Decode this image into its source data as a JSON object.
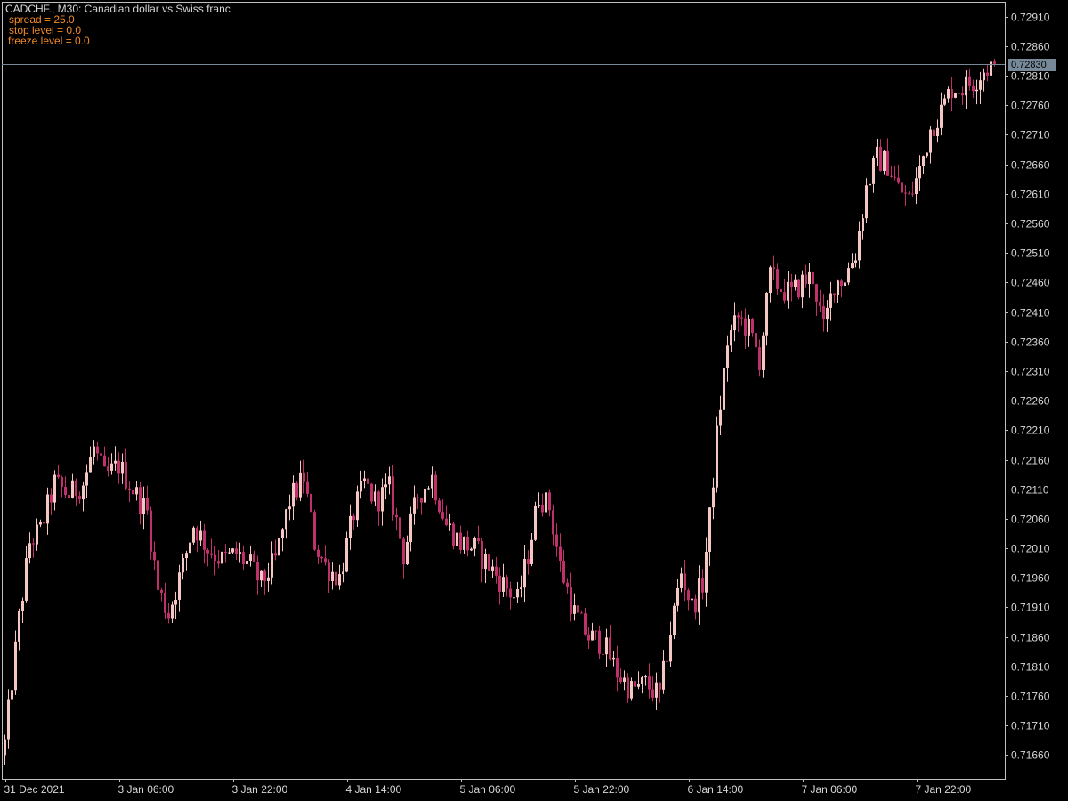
{
  "header": {
    "symbol": "CADCHF.",
    "timeframe": "M30",
    "description": "Canadian dollar vs Swiss franc",
    "title_text": "CADCHF., M30:  Canadian dollar vs Swiss franc"
  },
  "info_lines": [
    {
      "label": "spread",
      "value": "25.0",
      "text": "spread = 25.0"
    },
    {
      "label": "stop level",
      "value": "0.0",
      "text": "stop level = 0.0"
    },
    {
      "label": "freeze level",
      "value": "0.0",
      "text": "freeze level = 0.0"
    }
  ],
  "colors": {
    "background": "#000000",
    "axis": "#c0c0c0",
    "text": "#d7d7d7",
    "info_text": "#f08a24",
    "bull": "#f4c7c3",
    "bear": "#c0306a",
    "green": "#2e8b2e",
    "price_line": "#778899"
  },
  "current_price": {
    "value": 0.7283,
    "label": "0.72830"
  },
  "chart_data": {
    "type": "candlestick",
    "title": "CADCHF., M30:  Canadian dollar vs Swiss franc",
    "ylim": [
      0.7162,
      0.72935
    ],
    "y_ticks": [
      {
        "value": 0.7291,
        "label": "0.72910"
      },
      {
        "value": 0.7286,
        "label": "0.72860"
      },
      {
        "value": 0.7281,
        "label": "0.72810"
      },
      {
        "value": 0.7276,
        "label": "0.72760"
      },
      {
        "value": 0.7271,
        "label": "0.72710"
      },
      {
        "value": 0.7266,
        "label": "0.72660"
      },
      {
        "value": 0.7261,
        "label": "0.72610"
      },
      {
        "value": 0.7256,
        "label": "0.72560"
      },
      {
        "value": 0.7251,
        "label": "0.72510"
      },
      {
        "value": 0.7246,
        "label": "0.72460"
      },
      {
        "value": 0.7241,
        "label": "0.72410"
      },
      {
        "value": 0.7236,
        "label": "0.72360"
      },
      {
        "value": 0.7231,
        "label": "0.72310"
      },
      {
        "value": 0.7226,
        "label": "0.72260"
      },
      {
        "value": 0.7221,
        "label": "0.72210"
      },
      {
        "value": 0.7216,
        "label": "0.72160"
      },
      {
        "value": 0.7211,
        "label": "0.72110"
      },
      {
        "value": 0.7206,
        "label": "0.72060"
      },
      {
        "value": 0.7201,
        "label": "0.72010"
      },
      {
        "value": 0.7196,
        "label": "0.71960"
      },
      {
        "value": 0.7191,
        "label": "0.71910"
      },
      {
        "value": 0.7186,
        "label": "0.71860"
      },
      {
        "value": 0.7181,
        "label": "0.71810"
      },
      {
        "value": 0.7176,
        "label": "0.71760"
      },
      {
        "value": 0.7171,
        "label": "0.71710"
      },
      {
        "value": 0.7166,
        "label": "0.71660"
      }
    ],
    "x_ticks": [
      {
        "bar": 0,
        "label": "31 Dec 2021"
      },
      {
        "bar": 32,
        "label": "3 Jan 06:00"
      },
      {
        "bar": 64,
        "label": "3 Jan 22:00"
      },
      {
        "bar": 96,
        "label": "4 Jan 14:00"
      },
      {
        "bar": 128,
        "label": "5 Jan 06:00"
      },
      {
        "bar": 160,
        "label": "5 Jan 22:00"
      },
      {
        "bar": 192,
        "label": "6 Jan 14:00"
      },
      {
        "bar": 224,
        "label": "7 Jan 06:00"
      },
      {
        "bar": 256,
        "label": "7 Jan 22:00"
      }
    ],
    "close_path": [
      [
        0,
        0.7168
      ],
      [
        4,
        0.7189
      ],
      [
        7,
        0.7202
      ],
      [
        10,
        0.7204
      ],
      [
        14,
        0.7212
      ],
      [
        18,
        0.721
      ],
      [
        22,
        0.7212
      ],
      [
        25,
        0.7218
      ],
      [
        28,
        0.7213
      ],
      [
        32,
        0.7215
      ],
      [
        36,
        0.7211
      ],
      [
        40,
        0.7207
      ],
      [
        43,
        0.7194
      ],
      [
        46,
        0.719
      ],
      [
        50,
        0.7198
      ],
      [
        53,
        0.7205
      ],
      [
        57,
        0.7201
      ],
      [
        61,
        0.7199
      ],
      [
        65,
        0.72
      ],
      [
        69,
        0.7198
      ],
      [
        72,
        0.7195
      ],
      [
        76,
        0.7199
      ],
      [
        80,
        0.7209
      ],
      [
        84,
        0.7213
      ],
      [
        87,
        0.7202
      ],
      [
        90,
        0.7198
      ],
      [
        94,
        0.7196
      ],
      [
        98,
        0.7207
      ],
      [
        101,
        0.7212
      ],
      [
        104,
        0.7209
      ],
      [
        108,
        0.7211
      ],
      [
        112,
        0.72
      ],
      [
        116,
        0.721
      ],
      [
        120,
        0.7213
      ],
      [
        124,
        0.7205
      ],
      [
        128,
        0.7202
      ],
      [
        132,
        0.7201
      ],
      [
        136,
        0.7198
      ],
      [
        140,
        0.7195
      ],
      [
        144,
        0.7192
      ],
      [
        147,
        0.72
      ],
      [
        150,
        0.721
      ],
      [
        153,
        0.7208
      ],
      [
        156,
        0.7198
      ],
      [
        160,
        0.719
      ],
      [
        164,
        0.7186
      ],
      [
        168,
        0.7185
      ],
      [
        172,
        0.718
      ],
      [
        176,
        0.7177
      ],
      [
        180,
        0.7178
      ],
      [
        184,
        0.7176
      ],
      [
        187,
        0.7187
      ],
      [
        190,
        0.7197
      ],
      [
        193,
        0.7191
      ],
      [
        196,
        0.7195
      ],
      [
        198,
        0.7206
      ],
      [
        200,
        0.722
      ],
      [
        203,
        0.7236
      ],
      [
        206,
        0.724
      ],
      [
        209,
        0.7238
      ],
      [
        212,
        0.7233
      ],
      [
        215,
        0.7247
      ],
      [
        218,
        0.7245
      ],
      [
        221,
        0.7244
      ],
      [
        224,
        0.7246
      ],
      [
        227,
        0.7247
      ],
      [
        230,
        0.7238
      ],
      [
        233,
        0.7246
      ],
      [
        236,
        0.7247
      ],
      [
        239,
        0.7251
      ],
      [
        242,
        0.7262
      ],
      [
        245,
        0.7267
      ],
      [
        248,
        0.7266
      ],
      [
        251,
        0.7262
      ],
      [
        254,
        0.726
      ],
      [
        257,
        0.7265
      ],
      [
        260,
        0.7272
      ],
      [
        263,
        0.7275
      ],
      [
        266,
        0.7279
      ],
      [
        269,
        0.7279
      ],
      [
        272,
        0.728
      ],
      [
        275,
        0.7282
      ],
      [
        278,
        0.7283
      ]
    ],
    "bar_count": 279
  }
}
